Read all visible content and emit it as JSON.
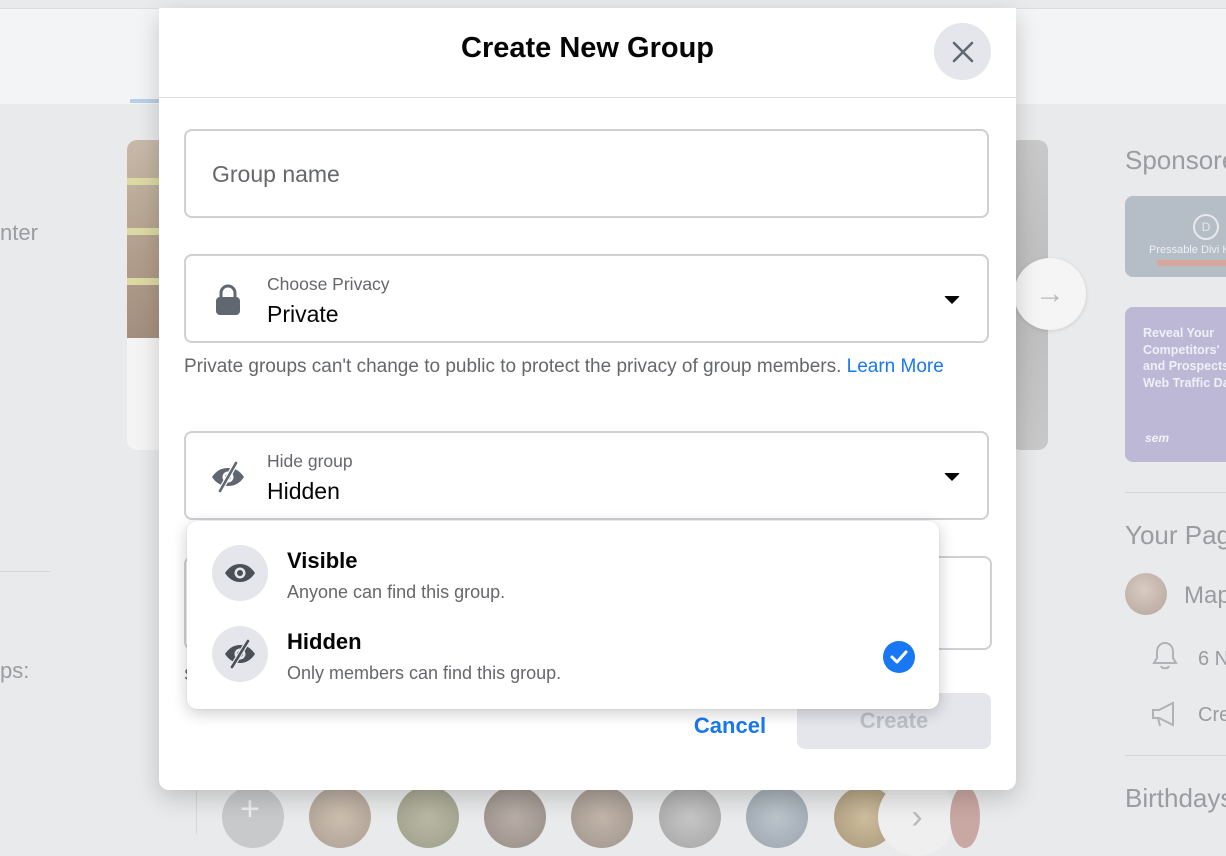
{
  "background": {
    "left_texts": [
      "nter",
      "ps:"
    ],
    "right_headings": [
      "Sponsored",
      "Your Pages",
      "Birthdays"
    ],
    "ad1": {
      "caption": "Pressable Divi H"
    },
    "ad2": {
      "text": "Reveal Your Competitors' and Prospects' Web Traffic Data",
      "brand": "sem"
    },
    "page_name": "Map",
    "notifications": "6 N",
    "create_label": "Cre"
  },
  "modal": {
    "title": "Create New Group",
    "group_name": {
      "placeholder": "Group name",
      "value": ""
    },
    "privacy": {
      "label": "Choose Privacy",
      "value": "Private",
      "icon": "lock-icon"
    },
    "privacy_note": {
      "text": "Private groups can't change to public to protect the privacy of group members.",
      "link": "Learn More"
    },
    "hide_group": {
      "label": "Hide group",
      "value": "Hidden",
      "icon": "eye-slash-icon"
    },
    "underlying_char": "S",
    "footer": {
      "cancel_label": "Cancel",
      "create_label": "Create"
    }
  },
  "dropdown": {
    "options": [
      {
        "title": "Visible",
        "description": "Anyone can find this group.",
        "icon": "eye-icon",
        "selected": false
      },
      {
        "title": "Hidden",
        "description": "Only members can find this group.",
        "icon": "eye-slash-icon",
        "selected": true
      }
    ]
  },
  "colors": {
    "accent": "#1877f2",
    "secondary_text": "#65676b",
    "button_gray": "#e4e6eb"
  }
}
